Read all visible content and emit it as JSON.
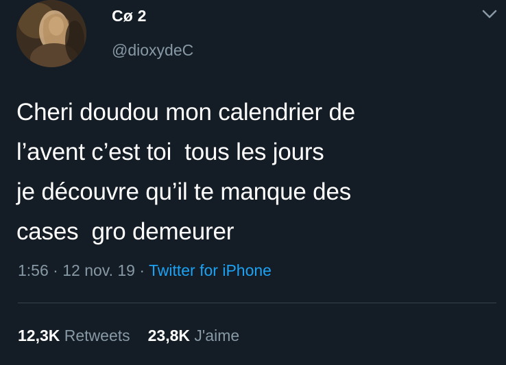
{
  "author": {
    "display_name": "Cø 2",
    "handle": "@dioxydeC"
  },
  "tweet": {
    "lines": [
      "Cheri doudou mon calendrier de",
      "l’avent c’est toi  tous les jours",
      "je découvre qu’il te manque des",
      "cases  gro demeurer"
    ],
    "time": "1:56",
    "date": "12 nov. 19",
    "separator": "·",
    "source": "Twitter for iPhone"
  },
  "stats": {
    "retweets_count": "12,3K",
    "retweets_label": "Retweets",
    "likes_count": "23,8K",
    "likes_label": "J'aime"
  },
  "icons": {
    "menu": "chevron-down-icon"
  },
  "colors": {
    "background": "#141d26",
    "text_primary": "#ffffff",
    "text_secondary": "#8899a6",
    "link": "#1da1f2",
    "divider": "#38444d"
  }
}
